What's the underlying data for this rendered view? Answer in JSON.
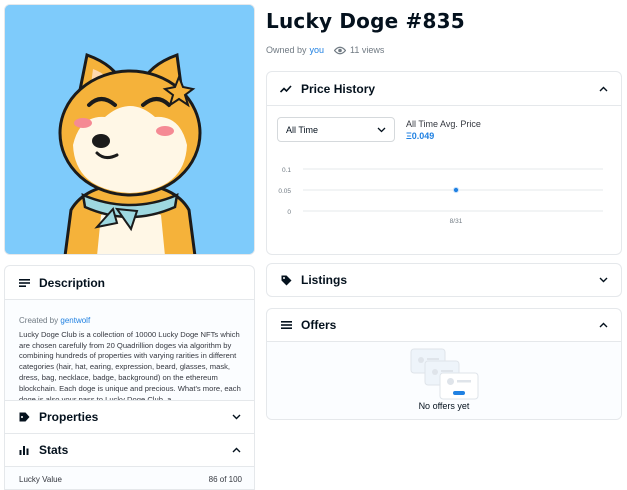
{
  "asset": {
    "title": "Lucky Doge #835",
    "owned_by_prefix": "Owned by",
    "owner": "you",
    "views": "11 views"
  },
  "price_history": {
    "header": "Price History",
    "range_selected": "All Time",
    "avg_label": "All Time Avg. Price",
    "avg_value": "Ξ0.049"
  },
  "chart_data": {
    "type": "scatter",
    "x": [
      "8/31"
    ],
    "y": [
      0.05
    ],
    "yticks": [
      0,
      0.05,
      0.1
    ],
    "ytick_labels": [
      "0",
      "0.05",
      "0.1"
    ],
    "xtick_labels": [
      "8/31"
    ],
    "ylim": [
      0,
      0.1
    ],
    "grid": true,
    "color": "#2081e2"
  },
  "description": {
    "header": "Description",
    "created_by_prefix": "Created by",
    "creator": "gentwolf",
    "text": "Lucky Doge Club is a collection of 10000 Lucky Doge NFTs which are chosen carefully from 20 Quadrillion doges via algorithm by combining hundreds of properties with varying rarities in different categories (hair, hat, earing, expression, beard, glasses, mask, dress, bag, necklace, badge, background) on the ethereum blockchain. Each doge is unique and precious. What's more, each doge is also your pass to Lucky Doge Club, a"
  },
  "properties": {
    "header": "Properties"
  },
  "stats": {
    "header": "Stats",
    "rows": [
      {
        "label": "Lucky Value",
        "value": "86 of 100"
      }
    ]
  },
  "listings": {
    "header": "Listings"
  },
  "offers": {
    "header": "Offers",
    "empty_text": "No offers yet"
  },
  "colors": {
    "accent": "#2081e2",
    "art_bg": "#7ecbfb",
    "dog": "#f5b23a",
    "scarf": "#9ed8e0"
  }
}
